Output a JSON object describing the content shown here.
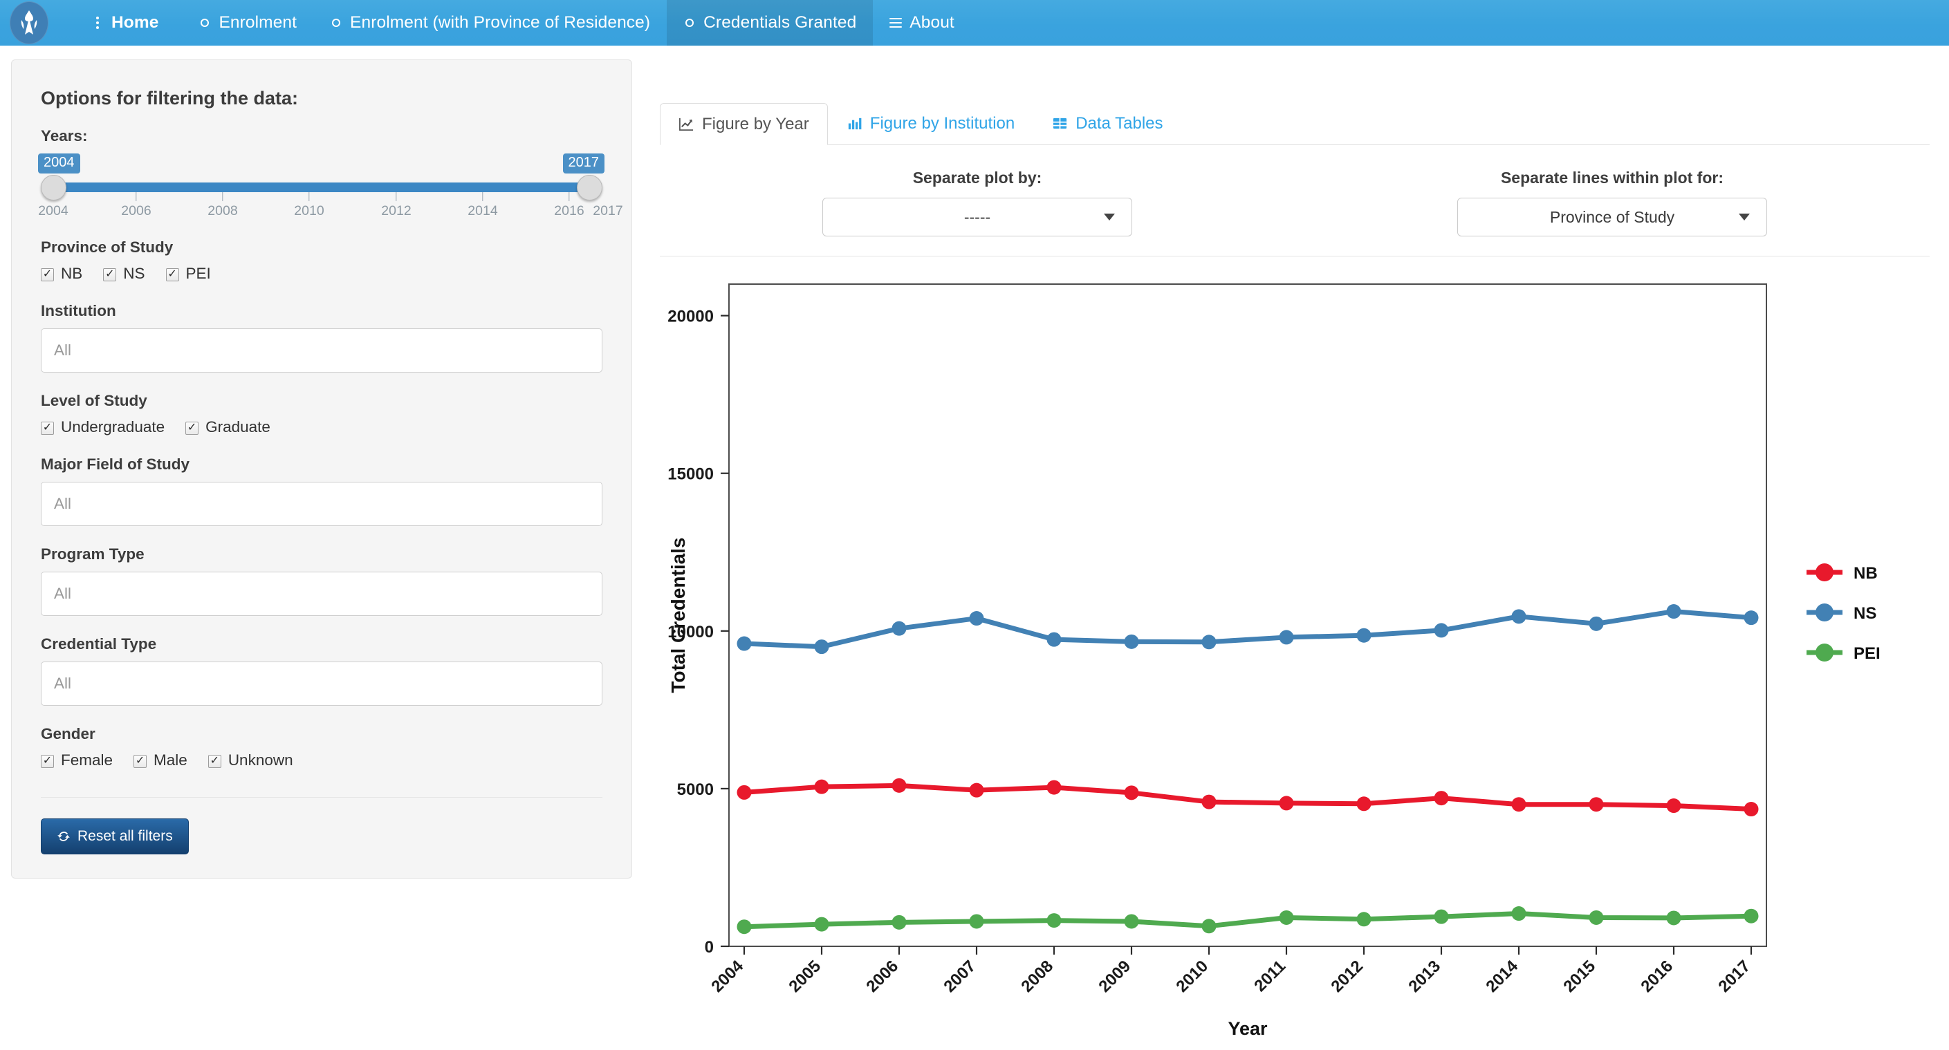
{
  "navbar": {
    "brand_name": "site-logo",
    "items": [
      {
        "label": "Home",
        "icon": "ellipsis-vertical-icon",
        "active": false,
        "bold": true
      },
      {
        "label": "Enrolment",
        "icon": "circle-icon",
        "active": false,
        "bold": false
      },
      {
        "label": "Enrolment (with Province of Residence)",
        "icon": "circle-icon",
        "active": false,
        "bold": false
      },
      {
        "label": "Credentials Granted",
        "icon": "circle-icon",
        "active": true,
        "bold": false
      },
      {
        "label": "About",
        "icon": "hamburger-icon",
        "active": false,
        "bold": false
      }
    ]
  },
  "sidebar": {
    "title": "Options for filtering the data:",
    "years": {
      "label": "Years:",
      "min_value": "2004",
      "max_value": "2017",
      "ticks": [
        "2004",
        "2006",
        "2008",
        "2010",
        "2012",
        "2014",
        "2016",
        "2017"
      ]
    },
    "province_of_study": {
      "label": "Province of Study",
      "options": [
        {
          "label": "NB",
          "checked": true
        },
        {
          "label": "NS",
          "checked": true
        },
        {
          "label": "PEI",
          "checked": true
        }
      ]
    },
    "institution": {
      "label": "Institution",
      "value": "All"
    },
    "level_of_study": {
      "label": "Level of Study",
      "options": [
        {
          "label": "Undergraduate",
          "checked": true
        },
        {
          "label": "Graduate",
          "checked": true
        }
      ]
    },
    "major_field_of_study": {
      "label": "Major Field of Study",
      "value": "All"
    },
    "program_type": {
      "label": "Program Type",
      "value": "All"
    },
    "credential_type": {
      "label": "Credential Type",
      "value": "All"
    },
    "gender": {
      "label": "Gender",
      "options": [
        {
          "label": "Female",
          "checked": true
        },
        {
          "label": "Male",
          "checked": true
        },
        {
          "label": "Unknown",
          "checked": true
        }
      ]
    },
    "reset_button": {
      "label": "Reset all filters",
      "icon": "refresh-icon"
    }
  },
  "main": {
    "tabs": [
      {
        "label": "Figure by Year",
        "icon": "line-chart-icon",
        "active": true
      },
      {
        "label": "Figure by Institution",
        "icon": "bar-chart-icon",
        "active": false
      },
      {
        "label": "Data Tables",
        "icon": "table-icon",
        "active": false
      }
    ],
    "separate_plot": {
      "label": "Separate plot by:",
      "value": "-----"
    },
    "separate_lines": {
      "label": "Separate lines within plot for:",
      "value": "Province of Study"
    }
  },
  "chart_data": {
    "type": "line",
    "title": "",
    "xlabel": "Year",
    "ylabel": "Total Credentials",
    "x": [
      "2004",
      "2005",
      "2006",
      "2007",
      "2008",
      "2009",
      "2010",
      "2011",
      "2012",
      "2013",
      "2014",
      "2015",
      "2016",
      "2017"
    ],
    "xtick_labels": [
      "2004",
      "2005",
      "2006",
      "2007",
      "2008",
      "2009",
      "2010",
      "2011",
      "2012",
      "2013",
      "2014",
      "2015",
      "2016",
      "2017"
    ],
    "ytick_labels": [
      "0",
      "5000",
      "10000",
      "15000",
      "20000"
    ],
    "yticks": [
      0,
      5000,
      10000,
      15000,
      20000
    ],
    "ylim": [
      0,
      21000
    ],
    "grid": false,
    "legend_position": "right",
    "series": [
      {
        "name": "NB",
        "color": "#e8192c",
        "values": [
          4880,
          5060,
          5100,
          4950,
          5040,
          4870,
          4580,
          4540,
          4520,
          4700,
          4500,
          4500,
          4460,
          4350
        ]
      },
      {
        "name": "NS",
        "color": "#4281b4",
        "values": [
          9600,
          9500,
          10080,
          10400,
          9730,
          9660,
          9650,
          9800,
          9860,
          10020,
          10460,
          10230,
          10620,
          10420
        ]
      },
      {
        "name": "PEI",
        "color": "#4faa4f",
        "values": [
          620,
          700,
          760,
          790,
          820,
          790,
          640,
          910,
          860,
          940,
          1040,
          910,
          900,
          960
        ]
      }
    ]
  }
}
